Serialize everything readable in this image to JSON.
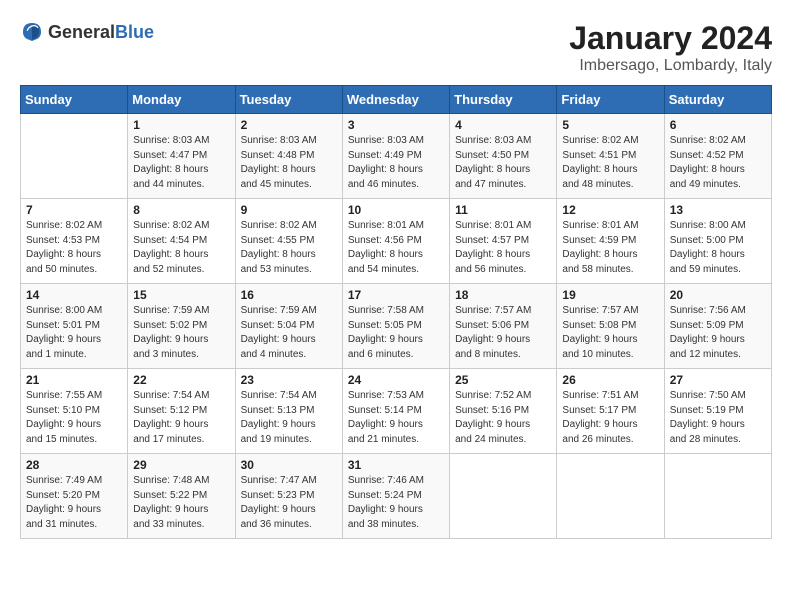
{
  "header": {
    "logo_general": "General",
    "logo_blue": "Blue",
    "month": "January 2024",
    "location": "Imbersago, Lombardy, Italy"
  },
  "days_of_week": [
    "Sunday",
    "Monday",
    "Tuesday",
    "Wednesday",
    "Thursday",
    "Friday",
    "Saturday"
  ],
  "weeks": [
    [
      {
        "day": "",
        "info": ""
      },
      {
        "day": "1",
        "info": "Sunrise: 8:03 AM\nSunset: 4:47 PM\nDaylight: 8 hours\nand 44 minutes."
      },
      {
        "day": "2",
        "info": "Sunrise: 8:03 AM\nSunset: 4:48 PM\nDaylight: 8 hours\nand 45 minutes."
      },
      {
        "day": "3",
        "info": "Sunrise: 8:03 AM\nSunset: 4:49 PM\nDaylight: 8 hours\nand 46 minutes."
      },
      {
        "day": "4",
        "info": "Sunrise: 8:03 AM\nSunset: 4:50 PM\nDaylight: 8 hours\nand 47 minutes."
      },
      {
        "day": "5",
        "info": "Sunrise: 8:02 AM\nSunset: 4:51 PM\nDaylight: 8 hours\nand 48 minutes."
      },
      {
        "day": "6",
        "info": "Sunrise: 8:02 AM\nSunset: 4:52 PM\nDaylight: 8 hours\nand 49 minutes."
      }
    ],
    [
      {
        "day": "7",
        "info": "Sunrise: 8:02 AM\nSunset: 4:53 PM\nDaylight: 8 hours\nand 50 minutes."
      },
      {
        "day": "8",
        "info": "Sunrise: 8:02 AM\nSunset: 4:54 PM\nDaylight: 8 hours\nand 52 minutes."
      },
      {
        "day": "9",
        "info": "Sunrise: 8:02 AM\nSunset: 4:55 PM\nDaylight: 8 hours\nand 53 minutes."
      },
      {
        "day": "10",
        "info": "Sunrise: 8:01 AM\nSunset: 4:56 PM\nDaylight: 8 hours\nand 54 minutes."
      },
      {
        "day": "11",
        "info": "Sunrise: 8:01 AM\nSunset: 4:57 PM\nDaylight: 8 hours\nand 56 minutes."
      },
      {
        "day": "12",
        "info": "Sunrise: 8:01 AM\nSunset: 4:59 PM\nDaylight: 8 hours\nand 58 minutes."
      },
      {
        "day": "13",
        "info": "Sunrise: 8:00 AM\nSunset: 5:00 PM\nDaylight: 8 hours\nand 59 minutes."
      }
    ],
    [
      {
        "day": "14",
        "info": "Sunrise: 8:00 AM\nSunset: 5:01 PM\nDaylight: 9 hours\nand 1 minute."
      },
      {
        "day": "15",
        "info": "Sunrise: 7:59 AM\nSunset: 5:02 PM\nDaylight: 9 hours\nand 3 minutes."
      },
      {
        "day": "16",
        "info": "Sunrise: 7:59 AM\nSunset: 5:04 PM\nDaylight: 9 hours\nand 4 minutes."
      },
      {
        "day": "17",
        "info": "Sunrise: 7:58 AM\nSunset: 5:05 PM\nDaylight: 9 hours\nand 6 minutes."
      },
      {
        "day": "18",
        "info": "Sunrise: 7:57 AM\nSunset: 5:06 PM\nDaylight: 9 hours\nand 8 minutes."
      },
      {
        "day": "19",
        "info": "Sunrise: 7:57 AM\nSunset: 5:08 PM\nDaylight: 9 hours\nand 10 minutes."
      },
      {
        "day": "20",
        "info": "Sunrise: 7:56 AM\nSunset: 5:09 PM\nDaylight: 9 hours\nand 12 minutes."
      }
    ],
    [
      {
        "day": "21",
        "info": "Sunrise: 7:55 AM\nSunset: 5:10 PM\nDaylight: 9 hours\nand 15 minutes."
      },
      {
        "day": "22",
        "info": "Sunrise: 7:54 AM\nSunset: 5:12 PM\nDaylight: 9 hours\nand 17 minutes."
      },
      {
        "day": "23",
        "info": "Sunrise: 7:54 AM\nSunset: 5:13 PM\nDaylight: 9 hours\nand 19 minutes."
      },
      {
        "day": "24",
        "info": "Sunrise: 7:53 AM\nSunset: 5:14 PM\nDaylight: 9 hours\nand 21 minutes."
      },
      {
        "day": "25",
        "info": "Sunrise: 7:52 AM\nSunset: 5:16 PM\nDaylight: 9 hours\nand 24 minutes."
      },
      {
        "day": "26",
        "info": "Sunrise: 7:51 AM\nSunset: 5:17 PM\nDaylight: 9 hours\nand 26 minutes."
      },
      {
        "day": "27",
        "info": "Sunrise: 7:50 AM\nSunset: 5:19 PM\nDaylight: 9 hours\nand 28 minutes."
      }
    ],
    [
      {
        "day": "28",
        "info": "Sunrise: 7:49 AM\nSunset: 5:20 PM\nDaylight: 9 hours\nand 31 minutes."
      },
      {
        "day": "29",
        "info": "Sunrise: 7:48 AM\nSunset: 5:22 PM\nDaylight: 9 hours\nand 33 minutes."
      },
      {
        "day": "30",
        "info": "Sunrise: 7:47 AM\nSunset: 5:23 PM\nDaylight: 9 hours\nand 36 minutes."
      },
      {
        "day": "31",
        "info": "Sunrise: 7:46 AM\nSunset: 5:24 PM\nDaylight: 9 hours\nand 38 minutes."
      },
      {
        "day": "",
        "info": ""
      },
      {
        "day": "",
        "info": ""
      },
      {
        "day": "",
        "info": ""
      }
    ]
  ]
}
